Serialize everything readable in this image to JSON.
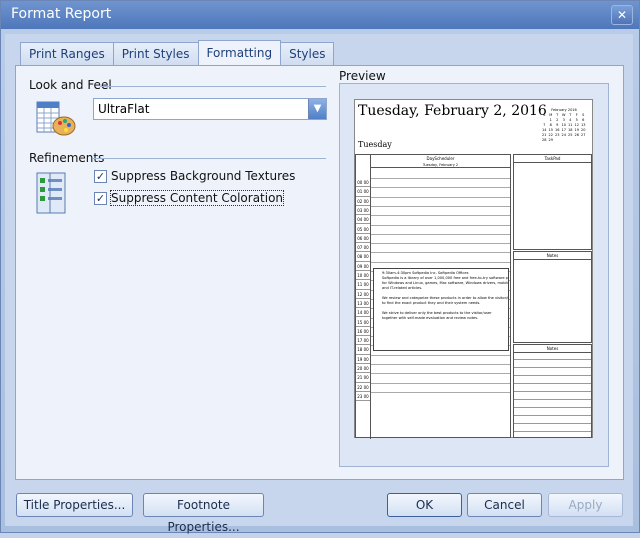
{
  "window": {
    "title": "Format Report",
    "close_glyph": "✕"
  },
  "tabs": [
    {
      "label": "Print Ranges",
      "active": false
    },
    {
      "label": "Print Styles",
      "active": false
    },
    {
      "label": "Formatting",
      "active": true
    },
    {
      "label": "Styles",
      "active": false
    }
  ],
  "look_and_feel": {
    "label": "Look and Feel",
    "value": "UltraFlat",
    "icon": "palette-icon"
  },
  "refinements": {
    "label": "Refinements",
    "icon": "checklist-icon",
    "options": [
      {
        "label": "Suppress Background Textures",
        "checked": true
      },
      {
        "label": "Suppress Content Coloration",
        "checked": true
      }
    ]
  },
  "preview": {
    "label": "Preview",
    "date_heading": "Tuesday, February 2, 2016",
    "day_label": "Tuesday",
    "mini_calendar": {
      "month": "February 2016",
      "days_header": [
        "S",
        "M",
        "T",
        "W",
        "T",
        "F",
        "S"
      ],
      "weeks": [
        [
          "",
          "1",
          "2",
          "3",
          "4",
          "5",
          "6"
        ],
        [
          "7",
          "8",
          "9",
          "10",
          "11",
          "12",
          "13"
        ],
        [
          "14",
          "15",
          "16",
          "17",
          "18",
          "19",
          "20"
        ],
        [
          "21",
          "22",
          "23",
          "24",
          "25",
          "26",
          "27"
        ],
        [
          "28",
          "29",
          "",
          "",
          "",
          "",
          ""
        ]
      ]
    },
    "schedule_header": "DayScheduler",
    "schedule_subheader": "Tuesday, February 2",
    "times": [
      "00 00",
      "01 00",
      "02 00",
      "03 00",
      "04 00",
      "05 00",
      "06 00",
      "07 00",
      "08 00",
      "09 00",
      "10 00",
      "11 00",
      "12 00",
      "13 00",
      "14 00",
      "15 00",
      "16 00",
      "17 00",
      "18 00",
      "19 00",
      "20 00",
      "21 00",
      "22 00",
      "23 00"
    ],
    "appointment": {
      "title": "9:30am-4:30pm Softpedia Inc. Softpedia Offices",
      "lines": [
        "Softpedia is a library of over 1,000,000 free and free-to-try software programs",
        "for Windows and Linux, games, Mac software, Windows drivers, mobile devices",
        "and IT-related articles.",
        "",
        "We review and categorize these products in order to allow the visitor/user",
        "to find the exact product they and their system needs.",
        "",
        "We strive to deliver only the best products to the visitor/user",
        "together with self-made evaluation and review notes."
      ]
    },
    "side_panels": [
      "TaskPad",
      "Notes",
      "Notes"
    ]
  },
  "footer_buttons": {
    "title_properties": "Title Properties...",
    "footnote_properties": "Footnote Properties...",
    "ok": "OK",
    "cancel": "Cancel",
    "apply": "Apply"
  }
}
